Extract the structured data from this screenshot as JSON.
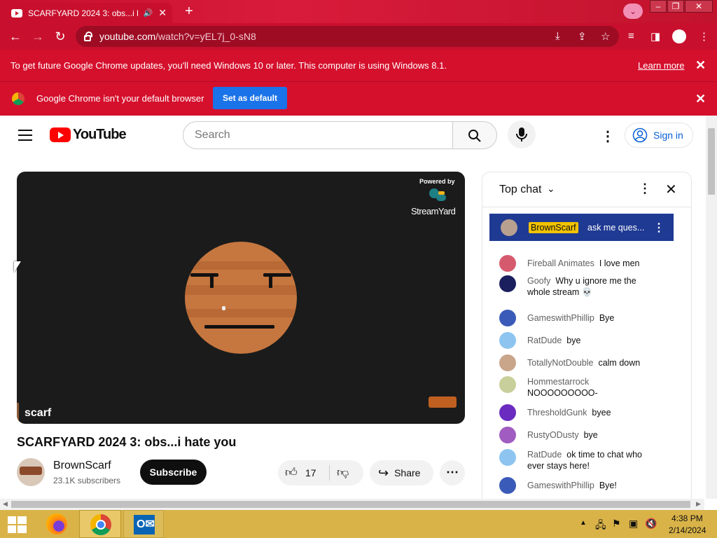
{
  "browser": {
    "tab_title": "SCARFYARD 2024 3: obs...i h",
    "url_host": "youtube.com",
    "url_path": "/watch?v=yEL7j_0-sN8",
    "infobar_update_text": "To get future Google Chrome updates, you'll need Windows 10 or later. This computer is using Windows 8.1.",
    "infobar_learn_more": "Learn more",
    "infobar_default_text": "Google Chrome isn't your default browser",
    "set_default_label": "Set as default"
  },
  "youtube": {
    "logo_text": "YouTube",
    "search_placeholder": "Search",
    "signin_label": "Sign in"
  },
  "video": {
    "powered_by": "Powered by",
    "streamyard": "StreamYard",
    "caption_name": "scarf",
    "title": "SCARFYARD 2024 3: obs...i hate you",
    "channel_name": "BrownScarf",
    "subscribers": "23.1K subscribers",
    "subscribe_label": "Subscribe",
    "likes": "17",
    "share_label": "Share"
  },
  "chat": {
    "header_label": "Top chat",
    "pinned": {
      "name": "BrownScarf",
      "message": "ask me ques..."
    },
    "messages": [
      {
        "name": "Fireball Animates",
        "message": "I love men"
      },
      {
        "name": "Goofy",
        "message": "Why u ignore me the whole stream 💀"
      },
      {
        "name": "GameswithPhillip",
        "message": "Bye"
      },
      {
        "name": "RatDude",
        "message": "bye"
      },
      {
        "name": "TotallyNotDouble",
        "message": "calm down"
      },
      {
        "name": "Hommestarrock",
        "message": "NOOOOOOOOO-"
      },
      {
        "name": "ThresholdGunk",
        "message": "byee"
      },
      {
        "name": "RustyODusty",
        "message": "bye"
      },
      {
        "name": "RatDude",
        "message": "ok time to chat who ever stays here!"
      },
      {
        "name": "GameswithPhillip",
        "message": "Bye!"
      }
    ]
  },
  "taskbar": {
    "time": "4:38 PM",
    "date": "2/14/2024"
  },
  "colors": {
    "chrome_red": "#c8102e",
    "yt_red": "#ff0000",
    "chat_pinned_bg": "#1f3a93",
    "link_blue": "#065fd4"
  }
}
